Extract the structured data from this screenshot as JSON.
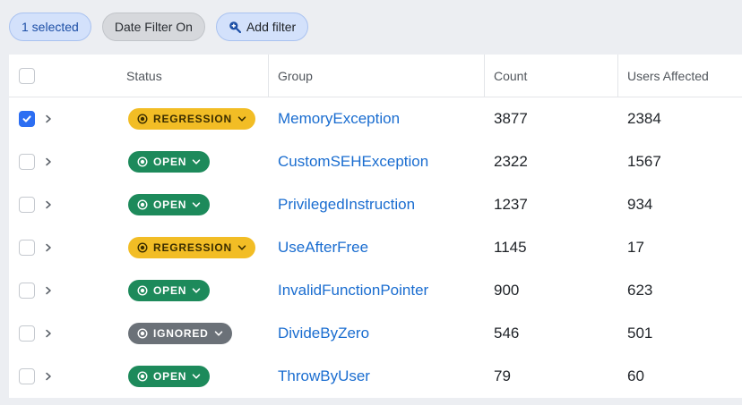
{
  "filters": {
    "selected_label": "1 selected",
    "date_filter_label": "Date Filter On",
    "add_filter_label": "Add filter"
  },
  "table": {
    "columns": {
      "status": "Status",
      "group": "Group",
      "count": "Count",
      "users": "Users Affected"
    },
    "rows": [
      {
        "checked": true,
        "status": "REGRESSION",
        "status_kind": "regression",
        "group": "MemoryException",
        "count": "3877",
        "users": "2384"
      },
      {
        "checked": false,
        "status": "OPEN",
        "status_kind": "open",
        "group": "CustomSEHException",
        "count": "2322",
        "users": "1567"
      },
      {
        "checked": false,
        "status": "OPEN",
        "status_kind": "open",
        "group": "PrivilegedInstruction",
        "count": "1237",
        "users": "934"
      },
      {
        "checked": false,
        "status": "REGRESSION",
        "status_kind": "regression",
        "group": "UseAfterFree",
        "count": "1145",
        "users": "17"
      },
      {
        "checked": false,
        "status": "OPEN",
        "status_kind": "open",
        "group": "InvalidFunctionPointer",
        "count": "900",
        "users": "623"
      },
      {
        "checked": false,
        "status": "IGNORED",
        "status_kind": "ignored",
        "group": "DivideByZero",
        "count": "546",
        "users": "501"
      },
      {
        "checked": false,
        "status": "OPEN",
        "status_kind": "open",
        "group": "ThrowByUser",
        "count": "79",
        "users": "60"
      }
    ]
  },
  "colors": {
    "regression": "#f2bd25",
    "open": "#1d8a5b",
    "ignored": "#6b7178",
    "link": "#1a6dd0",
    "accent": "#2c6ef2"
  }
}
